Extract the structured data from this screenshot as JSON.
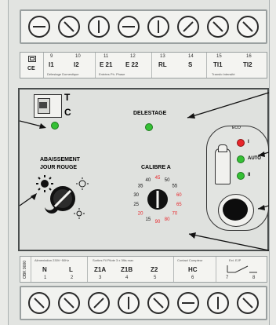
{
  "top_terminal_numbers": [
    "9",
    "10",
    "11",
    "12",
    "13",
    "14",
    "15",
    "16"
  ],
  "top_terminal_labels": [
    "I1",
    "I2",
    "E 21",
    "E 22",
    "RL",
    "S",
    "TI1",
    "TI2"
  ],
  "top_captions": [
    "Délestage Domestique",
    "Entrées Ph. Phase",
    "",
    "Transfo Intensité"
  ],
  "logo_text": "CE",
  "switch_label_t": "T",
  "switch_label_c": "C",
  "delestage_label": "DELESTAGE",
  "abaissement_label_line1": "ABAISSEMENT",
  "abaissement_label_line2": "JOUR ROUGE",
  "calibre_label": "CALIBRE A",
  "dial_values": [
    "45",
    "50",
    "55",
    "60",
    "65",
    "70",
    "80",
    "90",
    "15",
    "20",
    "25",
    "30",
    "35",
    "40"
  ],
  "eco_label": "ECO",
  "mode_labels": [
    "I",
    "AUTO",
    "II"
  ],
  "bottom_terminal_numbers": [
    "1",
    "2",
    "3",
    "4",
    "5",
    "6",
    "7",
    "8"
  ],
  "bottom_terminal_labels": [
    "N",
    "L",
    "Z1A",
    "Z1B",
    "Z2",
    "HC",
    "",
    ""
  ],
  "bottom_captions": [
    "Alimentation 230V~50Hz",
    "Sorties Fil Pilote 3 x 3fils max",
    "Contact Compteur",
    "Ext. EJP"
  ],
  "side_text": "OBK 9000",
  "colors": {
    "led_green": "#35c035",
    "led_red": "#e8262b",
    "dial_red": "#e8262b"
  }
}
